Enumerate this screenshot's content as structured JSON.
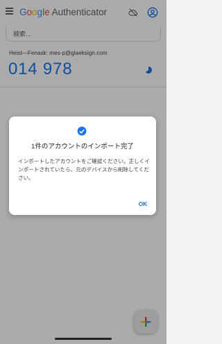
{
  "app": {
    "title_parts": {
      "g1": "G",
      "o1": "o",
      "o2": "o",
      "g2": "g",
      "l": "l",
      "e": "e",
      "rest": " Authenticator"
    }
  },
  "search": {
    "placeholder": "検索..."
  },
  "account": {
    "name": "Heist—Fenask: mes-p@glaeksign.com",
    "code": "014 978"
  },
  "dialog": {
    "title": "1件のアカウントのインポート完了",
    "body": "インポートしたアカウントをご確認ください。正しくインポートされていたら、元のデバイスから削除してください。",
    "ok_label": "OK"
  },
  "icons": {
    "menu": "menu-icon",
    "cloud": "cloud-off-icon",
    "account": "account-circle-icon",
    "timer": "timer-pie-icon",
    "check": "check-circle-icon",
    "add": "add-icon"
  },
  "colors": {
    "accent": "#1a73e8",
    "scrim": "#000000"
  }
}
